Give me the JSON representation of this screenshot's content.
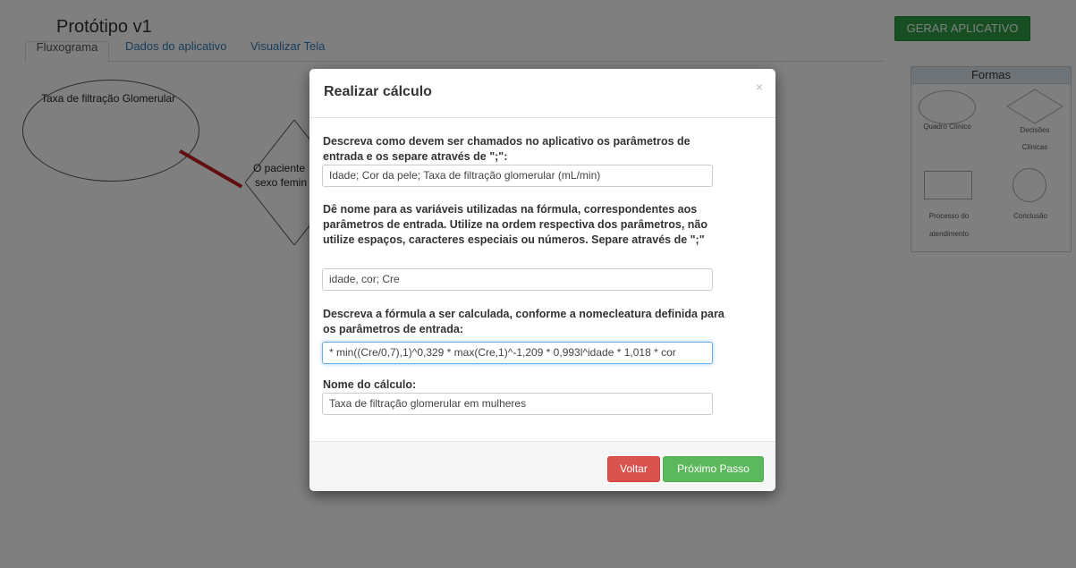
{
  "app": {
    "title": "Protótipo v1",
    "generate_button": "GERAR APLICATIVO",
    "tabs": [
      {
        "label": "Fluxograma",
        "active": true
      },
      {
        "label": "Dados do aplicativo",
        "active": false
      },
      {
        "label": "Visualizar Tela",
        "active": false
      }
    ]
  },
  "canvas": {
    "ellipse_node_label": "Taxa de filtração Glomerular",
    "diamond_label_line1": "O paciente",
    "diamond_label_line2": "sexo femin",
    "connector_color": "#c41c1c"
  },
  "shapes_panel": {
    "title": "Formas",
    "items": [
      {
        "label": "Quadro Clínico",
        "shape": "ellipse"
      },
      {
        "label_line1": "Decisões",
        "label_line2": "Clínicas",
        "shape": "diamond"
      },
      {
        "label_line1": "Processo do",
        "label_line2": "atendimento",
        "shape": "rectangle"
      },
      {
        "label": "Conclusão",
        "shape": "circle"
      }
    ]
  },
  "modal": {
    "title": "Realizar cálculo",
    "close_icon": "×",
    "fields": [
      {
        "label": "Descreva como devem ser chamados no aplicativo os parâmetros de entrada e os separe através de \";\":",
        "value": "Idade;  Cor da pele; Taxa de filtração glomerular (mL/min)"
      },
      {
        "label": "Dê nome para as variáveis utilizadas na fórmula, correspondentes aos parâmetros de entrada. Utilize na ordem respectiva dos parâmetros, não utilize espaços, caracteres especiais ou números. Separe através de \";\"",
        "value": "idade, cor; Cre"
      },
      {
        "label": "Descreva a fórmula a ser calculada, conforme a nomecleatura definida para os parâmetros de entrada:",
        "value": "* min((Cre/0,7),1)^0,329 * max(Cre,1)^-1,209 * 0,993l^idade * 1,018 * cor"
      },
      {
        "label": "Nome do cálculo:",
        "value": "Taxa de filtração glomerular em mulheres"
      }
    ],
    "back_button": "Voltar",
    "next_button": "Próximo Passo"
  },
  "colors": {
    "primary_green": "#2e9e44",
    "danger": "#d9534f",
    "success": "#5cb85c",
    "overlay": "rgba(0,0,0,0.5)"
  }
}
